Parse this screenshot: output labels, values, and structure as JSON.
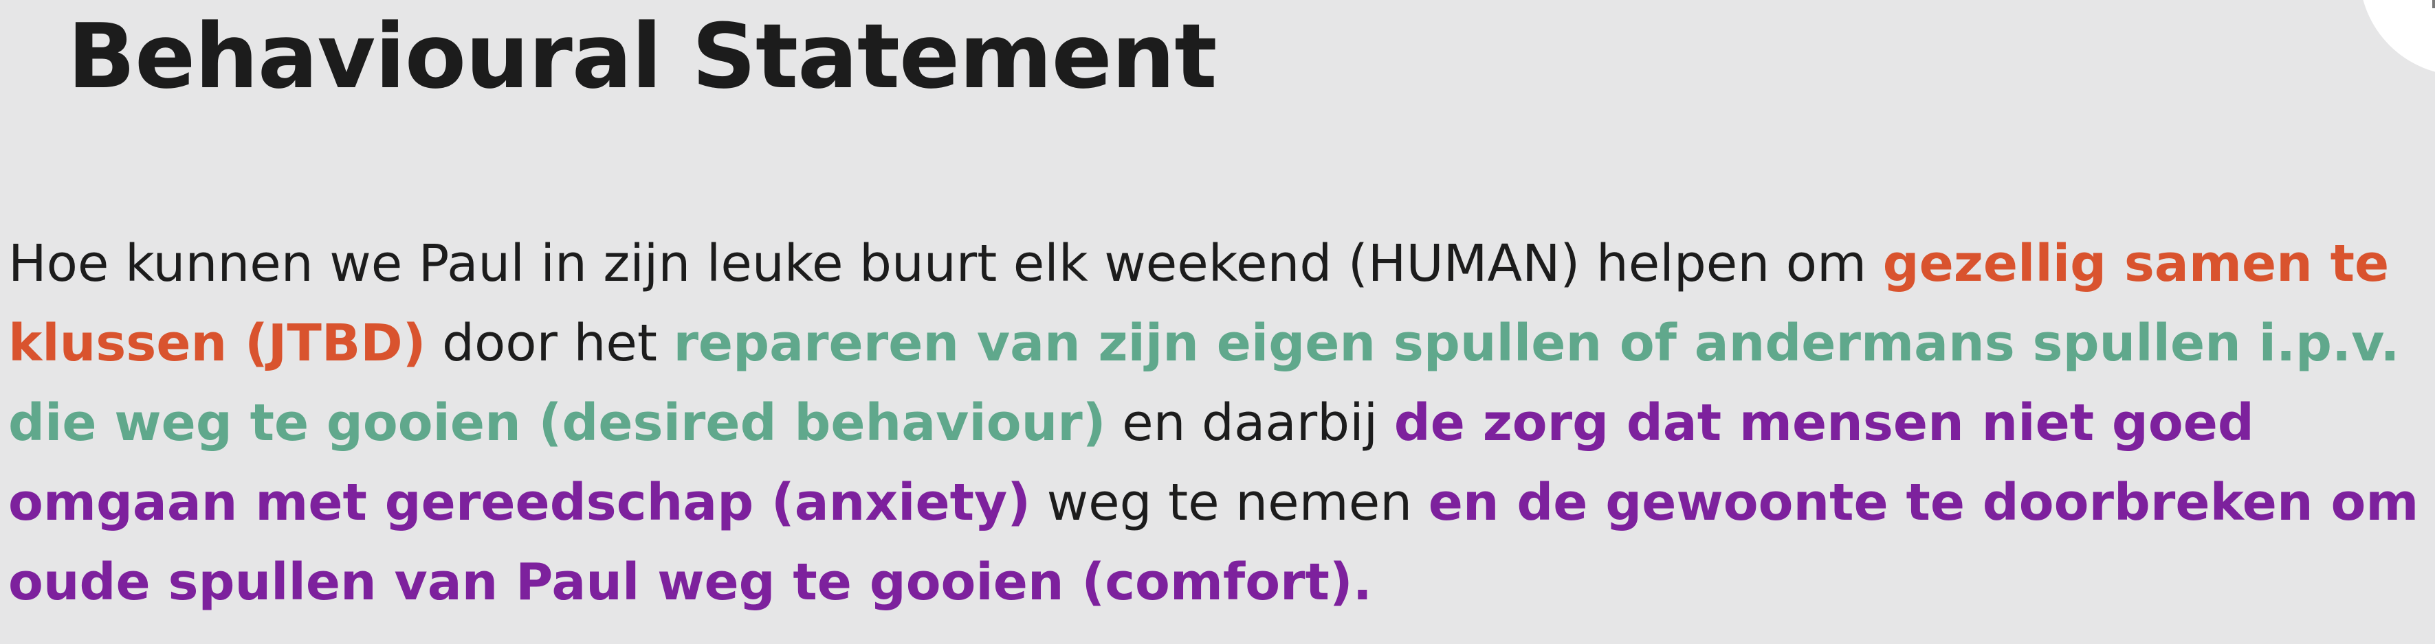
{
  "slide": {
    "title": "Behavioural Statement",
    "statement": {
      "seg1": "Hoe kunnen we Paul in zijn leuke buurt elk weekend (HUMAN) helpen om ",
      "jtbd": "gezellig samen te klussen (JTBD)",
      "seg2": " door het ",
      "desired_behaviour": "repareren van zijn eigen spullen of andermans spullen i.p.v. die weg te gooien (desired behaviour)",
      "seg3": " en daarbij ",
      "anxiety": "de zorg dat mensen niet goed omgaan met gereedschap (anxiety)",
      "seg4": " weg te nemen ",
      "comfort": "en de gewoonte te doorbreken om oude spullen van Paul weg te gooien (comfort)."
    }
  },
  "colors": {
    "background": "#e6e6e7",
    "text": "#1c1c1c",
    "jtbd": "#d9532e",
    "desired_behaviour": "#60a88c",
    "anxiety_comfort": "#7d219d"
  }
}
